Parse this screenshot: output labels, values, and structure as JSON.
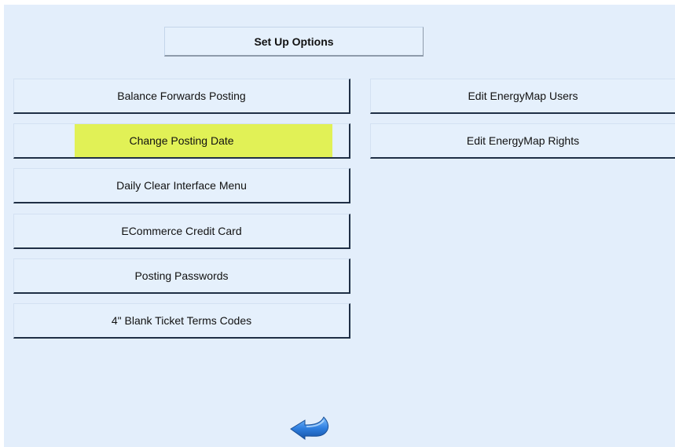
{
  "header": {
    "title": "Set Up Options"
  },
  "left_menu": [
    {
      "label": "Balance Forwards Posting"
    },
    {
      "label": "Change Posting Date",
      "highlighted": true,
      "highlight_color": "#e1f156"
    },
    {
      "label": "Daily Clear Interface Menu"
    },
    {
      "label": "ECommerce Credit Card"
    },
    {
      "label": "Posting Passwords"
    },
    {
      "label": "4\" Blank Ticket Terms Codes"
    }
  ],
  "right_menu": [
    {
      "label": "Edit EnergyMap Users"
    },
    {
      "label": "Edit EnergyMap Rights"
    }
  ],
  "footer": {
    "back_icon": "back-arrow-icon"
  },
  "colors": {
    "background": "#e3eefb",
    "button_face": "#e5f0fc",
    "button_shadow": "#1f2f45",
    "highlight": "#e1f156",
    "arrow": "#2f7fe0"
  }
}
